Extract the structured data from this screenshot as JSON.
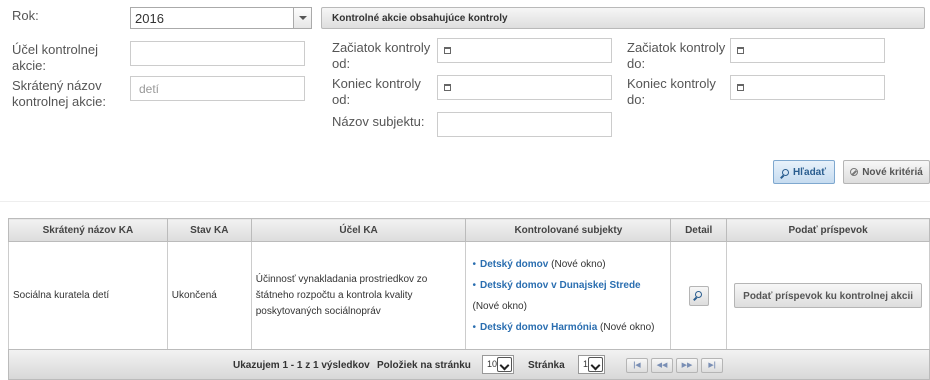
{
  "filters": {
    "year_label": "Rok:",
    "year_value": "2016",
    "tab_label": "Kontrolné akcie obsahujúce kontroly",
    "purpose_label_1": "Účel kontrolnej",
    "purpose_label_2": "akcie:",
    "purpose_value": "",
    "shortname_label_1": "Skrátený názov",
    "shortname_label_2": "kontrolnej akcie:",
    "shortname_placeholder": "detí",
    "start_from_label_1": "Začiatok kontroly",
    "start_from_label_2": "od:",
    "start_to_label_1": "Začiatok kontroly",
    "start_to_label_2": "do:",
    "end_from_label_1": "Koniec kontroly",
    "end_from_label_2": "od:",
    "end_to_label_1": "Koniec kontroly",
    "end_to_label_2": "do:",
    "subject_label": "Názov subjektu:",
    "subject_value": ""
  },
  "actions": {
    "search_label": "Hľadať",
    "new_criteria_label": "Nové kritériá"
  },
  "table": {
    "headers": [
      "Skrátený názov KA",
      "Stav KA",
      "Účel KA",
      "Kontrolované subjekty",
      "Detail",
      "Podať príspevok"
    ],
    "rows": [
      {
        "short_name": "Sociálna kuratela detí",
        "status": "Ukončená",
        "purpose": "Účinnosť vynakladania prostriedkov zo štátneho rozpočtu a kontrola kvality poskytovaných sociálnopráv",
        "subjects": [
          {
            "name": "Detský domov",
            "note": "(Nové okno)"
          },
          {
            "name": "Detský domov v Dunajskej Strede",
            "note": "(Nové okno)"
          },
          {
            "name": "Detský domov Harmónia",
            "note": "(Nové okno)"
          }
        ],
        "contribute_label": "Podať príspevok ku kontrolnej akcii"
      }
    ]
  },
  "pager": {
    "summary": "Ukazujem 1 - 1 z 1 výsledkov",
    "per_page_label": "Položiek na stránku",
    "per_page_value": "10",
    "page_label": "Stránka",
    "page_value": "1",
    "first": "|◀",
    "prev": "◀◀",
    "next": "▶▶",
    "last": "▶|"
  },
  "colors": {
    "link": "#2a6eb0",
    "accent_button": "#c6dcf0"
  }
}
